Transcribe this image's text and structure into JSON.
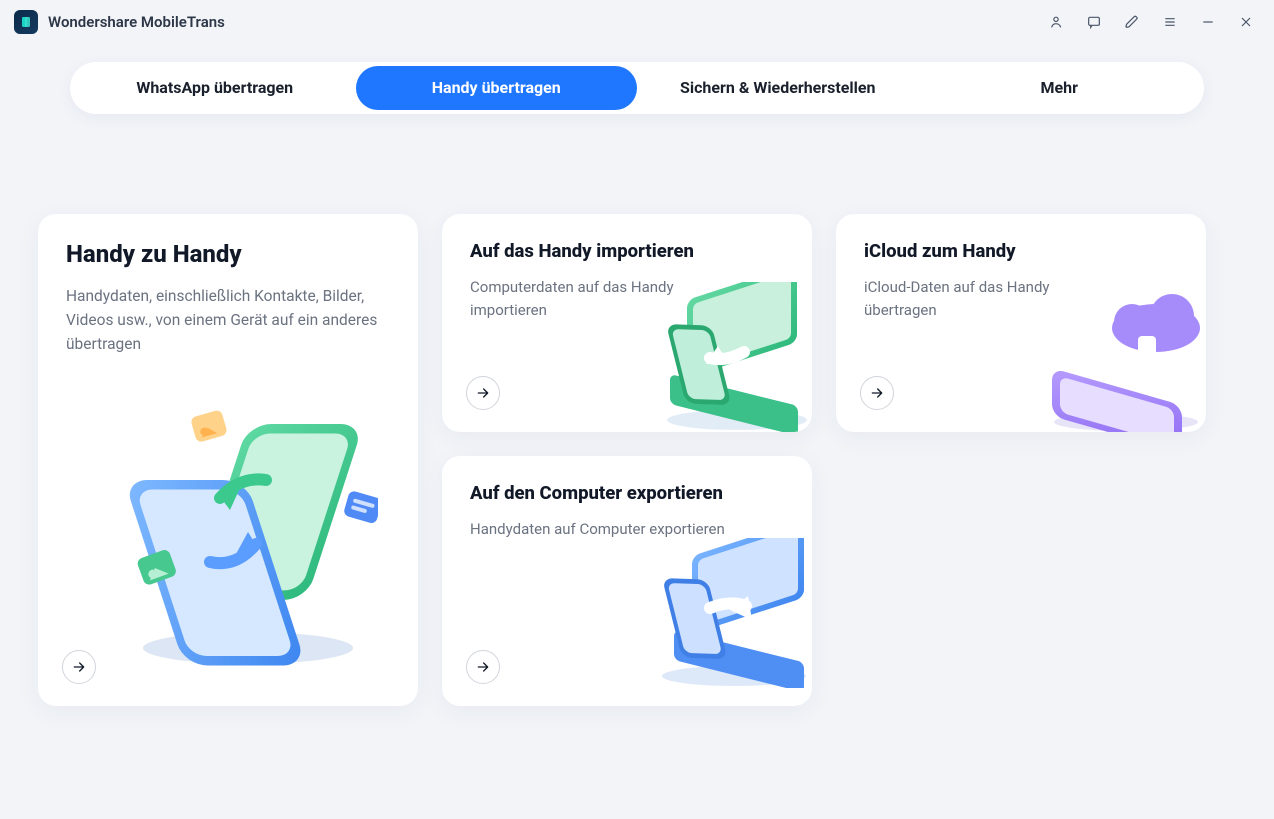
{
  "app": {
    "title": "Wondershare MobileTrans"
  },
  "tabs": [
    {
      "label": "WhatsApp übertragen",
      "active": false
    },
    {
      "label": "Handy übertragen",
      "active": true
    },
    {
      "label": "Sichern & Wiederherstellen",
      "active": false
    },
    {
      "label": "Mehr",
      "active": false
    }
  ],
  "cards": {
    "main": {
      "title": "Handy zu Handy",
      "desc": "Handydaten, einschließlich Kontakte, Bilder, Videos usw., von einem Gerät auf ein anderes übertragen"
    },
    "import": {
      "title": "Auf das Handy importieren",
      "desc": "Computerdaten auf das Handy importieren"
    },
    "icloud": {
      "title": "iCloud zum Handy",
      "desc": "iCloud-Daten auf das Handy übertragen"
    },
    "export": {
      "title": "Auf den Computer exportieren",
      "desc": "Handydaten auf Computer exportieren"
    }
  }
}
